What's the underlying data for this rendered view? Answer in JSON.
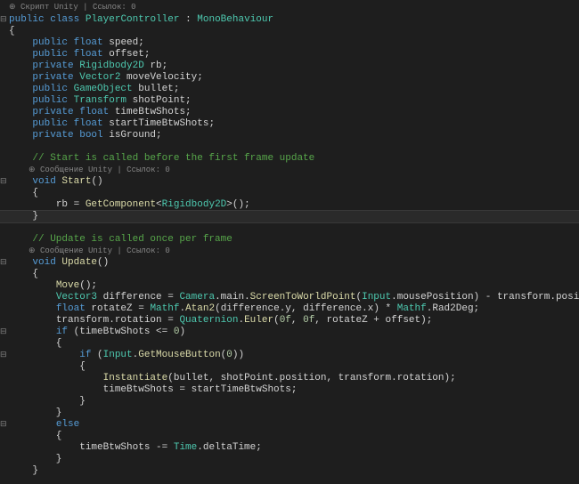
{
  "breadcrumb": "Скрипт Unity | Ссылок: 0",
  "codelens1": "Сообщение Unity | Ссылок: 0",
  "codelens2": "Сообщение Unity | Ссылок: 0",
  "code": {
    "classDecl": {
      "kw1": "public",
      "kw2": "class",
      "name": "PlayerController",
      "colon": " : ",
      "base": "MonoBehaviour"
    },
    "openBrace": "{",
    "fields": [
      {
        "mods": "    public ",
        "type": "float",
        "rest": " speed;"
      },
      {
        "mods": "    public ",
        "type": "float",
        "rest": " offset;"
      },
      {
        "mods": "    private ",
        "type": "Rigidbody2D",
        "rest": " rb;"
      },
      {
        "mods": "    private ",
        "type": "Vector2",
        "rest": " moveVelocity;"
      },
      {
        "mods": "    public ",
        "type": "GameObject",
        "rest": " bullet;"
      },
      {
        "mods": "    public ",
        "type": "Transform",
        "rest": " shotPoint;"
      },
      {
        "mods": "    private ",
        "type": "float",
        "rest": " timeBtwShots;"
      },
      {
        "mods": "    public ",
        "type": "float",
        "rest": " startTimeBtwShots;"
      },
      {
        "mods": "    private ",
        "type": "bool",
        "rest": " isGround;"
      }
    ],
    "cmtStart": "    // Start is called before the first frame update",
    "startSig": {
      "pre": "    ",
      "ret": "void",
      "sp": " ",
      "name": "Start",
      "paren": "()"
    },
    "startOpen": "    {",
    "startBody": {
      "indent": "        ",
      "lhs": "rb = ",
      "fn": "GetComponent",
      "lt": "<",
      "gen": "Rigidbody2D",
      "gt": ">",
      "call": "();"
    },
    "startClose": "    }",
    "cmtUpdate": "    // Update is called once per frame",
    "updateSig": {
      "pre": "    ",
      "ret": "void",
      "sp": " ",
      "name": "Update",
      "paren": "()"
    },
    "updateOpen": "    {",
    "uLine1": {
      "indent": "        ",
      "fn": "Move",
      "rest": "();"
    },
    "uLine2": {
      "indent": "        ",
      "type": "Vector3",
      "rest1": " difference = ",
      "cls2": "Camera",
      "rest2": ".main.",
      "fn2": "ScreenToWorldPoint",
      "rest3": "(",
      "cls3": "Input",
      "rest4": ".mousePosition) - transform.position;"
    },
    "uLine3": {
      "indent": "        ",
      "type": "float",
      "rest1": " rotateZ = ",
      "cls2": "Mathf",
      "rest2": ".",
      "fn2": "Atan2",
      "rest3": "(difference.y, difference.x) * ",
      "cls3": "Mathf",
      "rest4": ".Rad2Deg;"
    },
    "uLine4": {
      "indent": "        ",
      "rest1": "transform.rotation = ",
      "cls2": "Quaternion",
      "rest2": ".",
      "fn2": "Euler",
      "rest3": "(",
      "n1": "0f",
      "c1": ", ",
      "n2": "0f",
      "c2": ", rotateZ + offset);"
    },
    "uLine5": {
      "indent": "        ",
      "kw": "if",
      "rest": " (timeBtwShots <= ",
      "num": "0",
      "rest2": ")"
    },
    "uLine6": "        {",
    "uLine7": {
      "indent": "            ",
      "kw": "if",
      "rest": " (",
      "cls": "Input",
      "rest2": ".",
      "fn": "GetMouseButton",
      "rest3": "(",
      "num": "0",
      "rest4": "))"
    },
    "uLine8": "            {",
    "uLine9": {
      "indent": "                ",
      "fn": "Instantiate",
      "rest": "(bullet, shotPoint.position, transform.rotation);"
    },
    "uLine10": "                timeBtwShots = startTimeBtwShots;",
    "uLine11": "            }",
    "uLine12": "        }",
    "uLine13": {
      "indent": "        ",
      "kw": "else"
    },
    "uLine14": "        {",
    "uLine15": {
      "indent": "            ",
      "rest1": "timeBtwShots -= ",
      "cls": "Time",
      "rest2": ".deltaTime;"
    },
    "uLine16": "        }",
    "updateClose": "    }"
  }
}
